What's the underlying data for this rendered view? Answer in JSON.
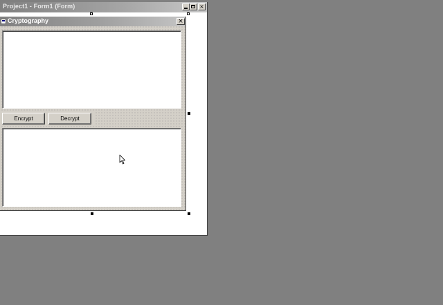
{
  "outer_window": {
    "title": "Project1 - Form1 (Form)",
    "minimize_glyph": "_",
    "maximize_glyph": "□",
    "close_glyph": "×"
  },
  "form": {
    "title": "Cryptography",
    "close_glyph": "×",
    "input_text_value": "",
    "output_text_value": "",
    "encrypt_label": "Encrypt",
    "decrypt_label": "Decrypt"
  },
  "icons": {
    "form_icon": "form-icon",
    "cursor": "mouse-pointer-icon"
  },
  "colors": {
    "desktop": "#808080",
    "face": "#d4d0c8",
    "title_gradient_start": "#808080",
    "title_gradient_end": "#c8c8c8"
  }
}
